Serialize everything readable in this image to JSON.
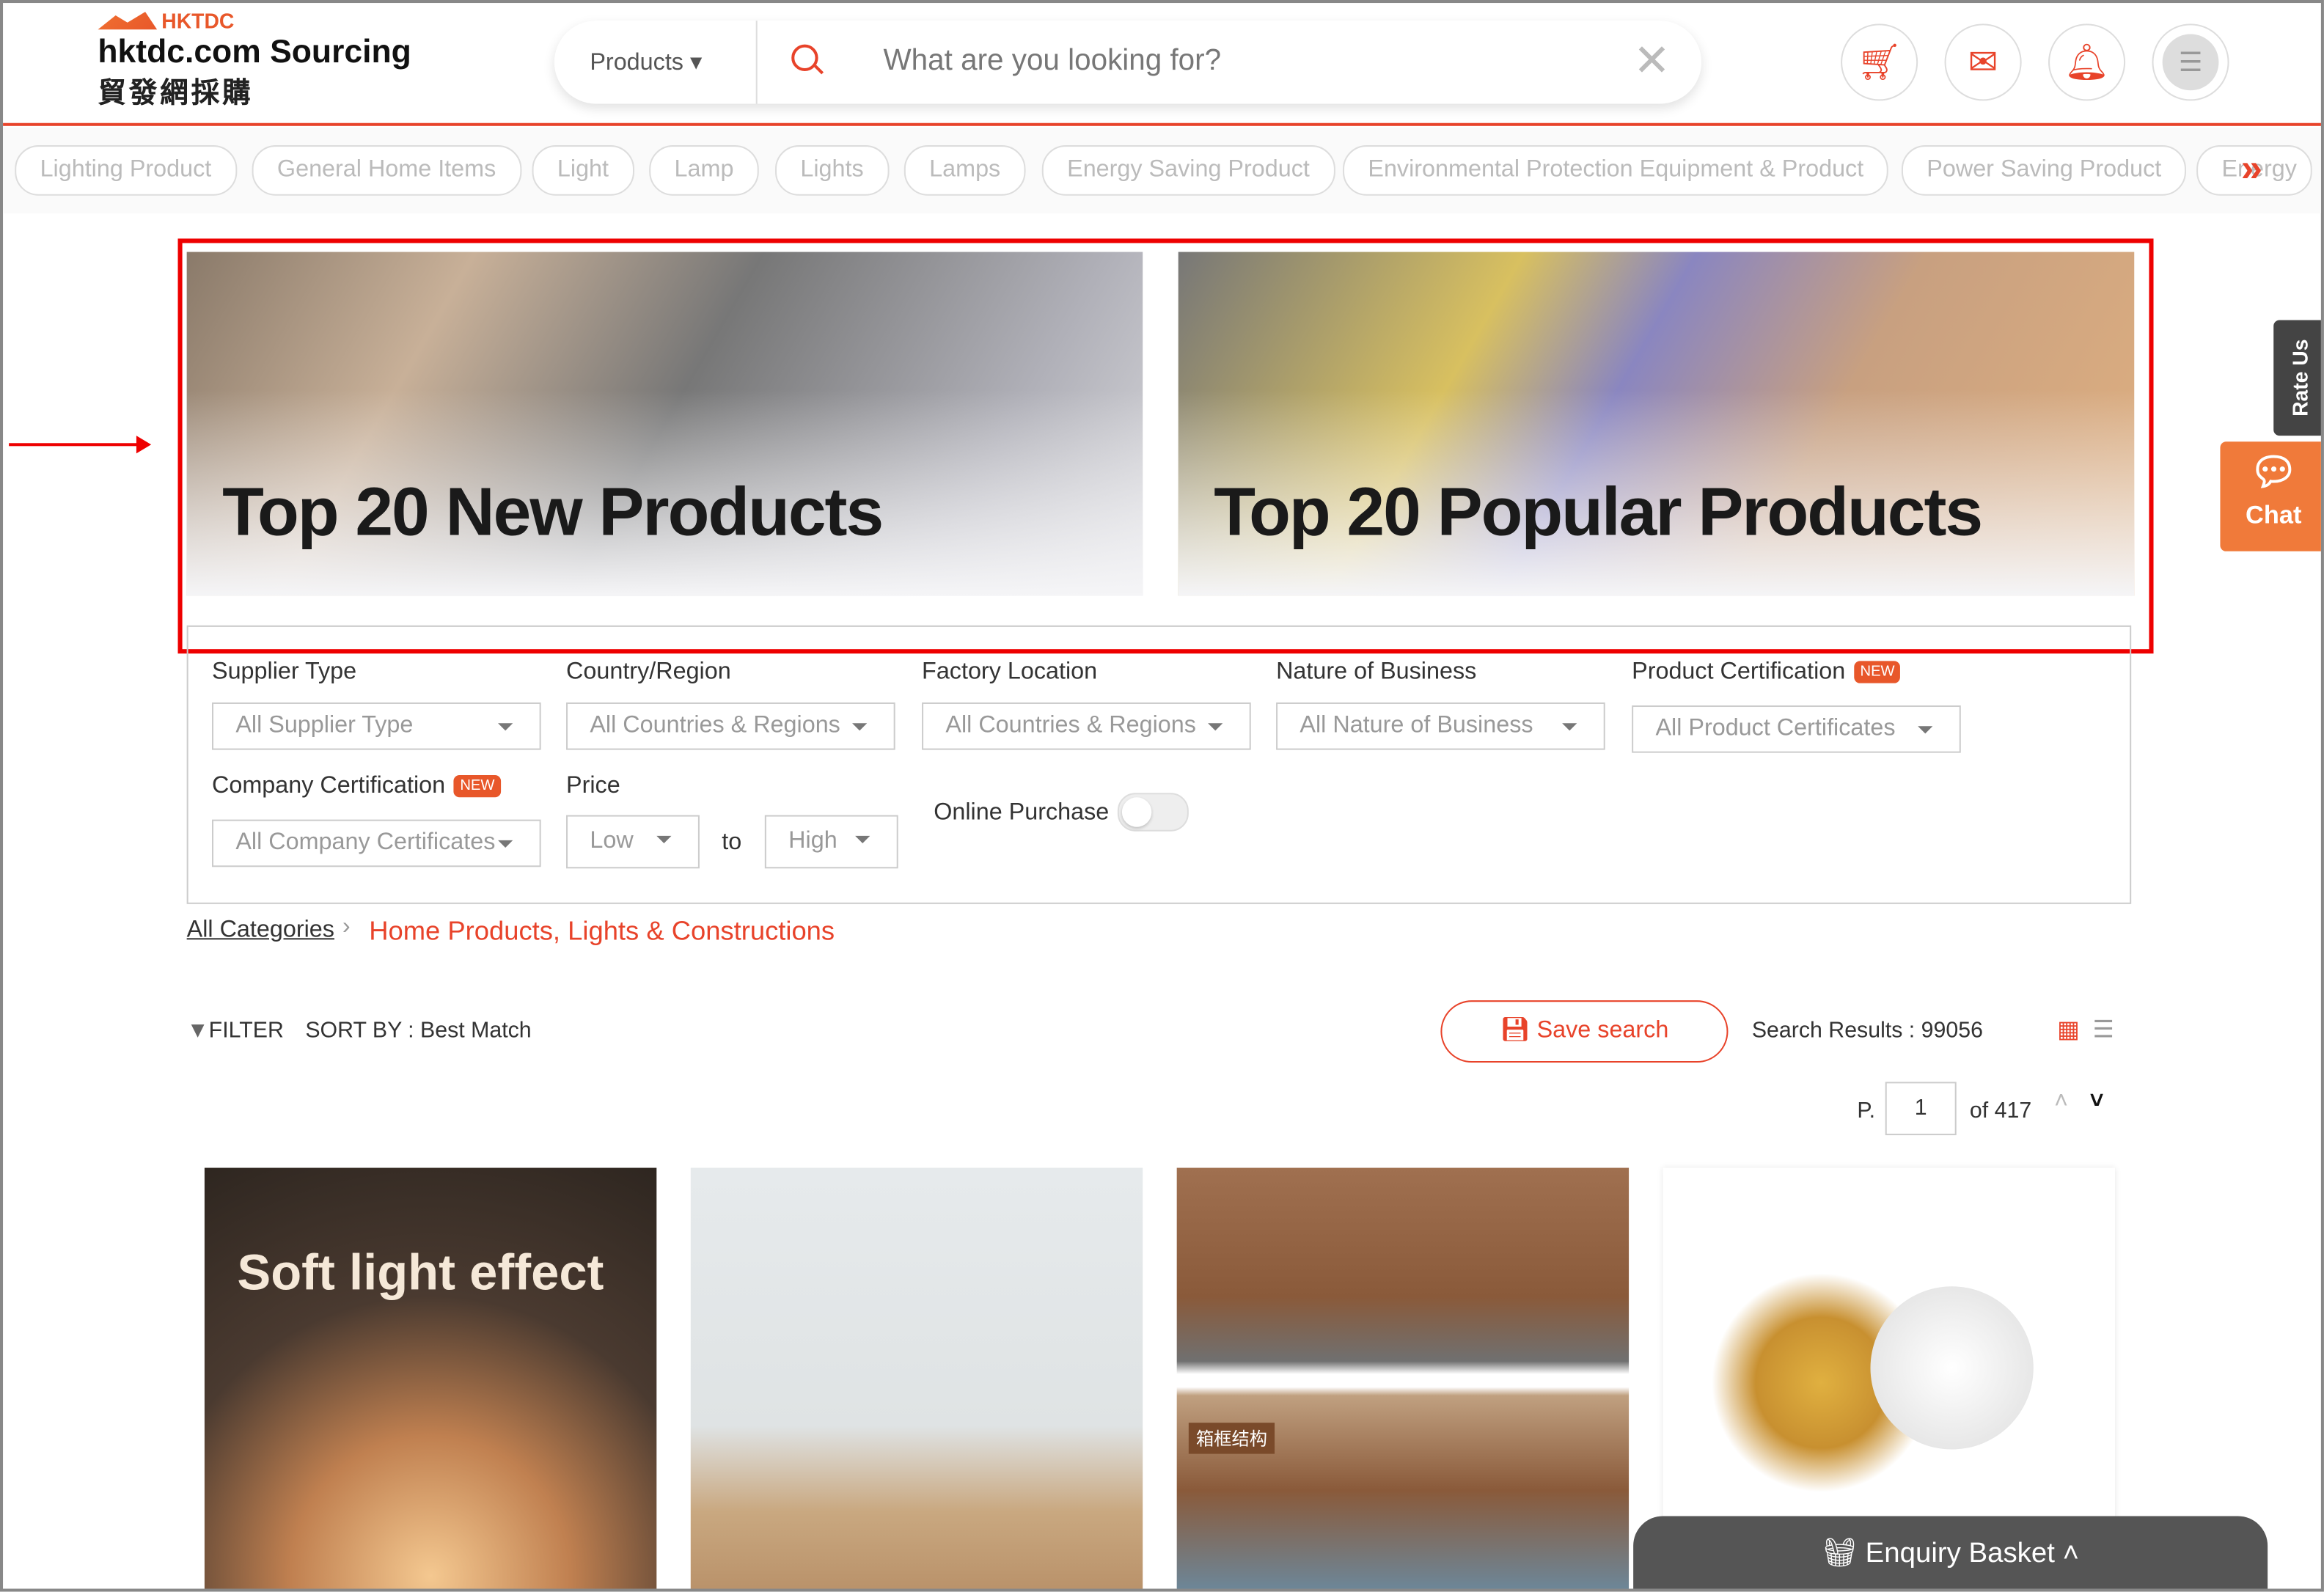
{
  "header": {
    "logo_mark": "HKTDC",
    "brand": "hktdc.com Sourcing",
    "brand_zh": "貿發網採購",
    "search_scope": "Products",
    "search_placeholder": "What are you looking for?"
  },
  "icons": [
    "cart-icon",
    "mail-icon",
    "bell-icon",
    "menu-icon"
  ],
  "tags": [
    "Lighting Product",
    "General Home Items",
    "Light",
    "Lamp",
    "Lights",
    "Lamps",
    "Energy Saving Product",
    "Environmental Protection Equipment & Product",
    "Power Saving Product",
    "Energy"
  ],
  "banners": [
    {
      "title": "Top 20 New Products"
    },
    {
      "title": "Top 20 Popular Products"
    }
  ],
  "filters": {
    "supplier_type": {
      "label": "Supplier Type",
      "value": "All Supplier Type"
    },
    "country": {
      "label": "Country/Region",
      "value": "All Countries & Regions"
    },
    "factory": {
      "label": "Factory Location",
      "value": "All Countries & Regions"
    },
    "nature": {
      "label": "Nature of Business",
      "value": "All Nature of Business"
    },
    "product_cert": {
      "label": "Product Certification",
      "value": "All Product Certificates",
      "badge": "NEW"
    },
    "company_cert": {
      "label": "Company Certification",
      "value": "All Company Certificates",
      "badge": "NEW"
    },
    "price": {
      "label": "Price",
      "low_placeholder": "Low",
      "to": "to",
      "high_placeholder": "High"
    },
    "online_purchase": {
      "label": "Online Purchase",
      "enabled": false
    }
  },
  "breadcrumb": {
    "root": "All Categories",
    "current": "Home Products, Lights & Constructions"
  },
  "results": {
    "filter": "FILTER",
    "sort": "SORT BY : Best Match",
    "save": "Save search",
    "count": "Search Results : 99056",
    "page_prefix": "P.",
    "page": "1",
    "page_of": "of 417"
  },
  "cards": [
    {
      "text": "Soft light effect"
    },
    {
      "text": ""
    },
    {
      "text": "箱框结构"
    },
    {
      "text": ""
    }
  ],
  "side": {
    "rate": "Rate Us",
    "chat": "Chat"
  },
  "basket": {
    "label": "Enquiry Basket"
  },
  "colors": {
    "accent": "#e8432a",
    "highlight": "#e00000"
  }
}
